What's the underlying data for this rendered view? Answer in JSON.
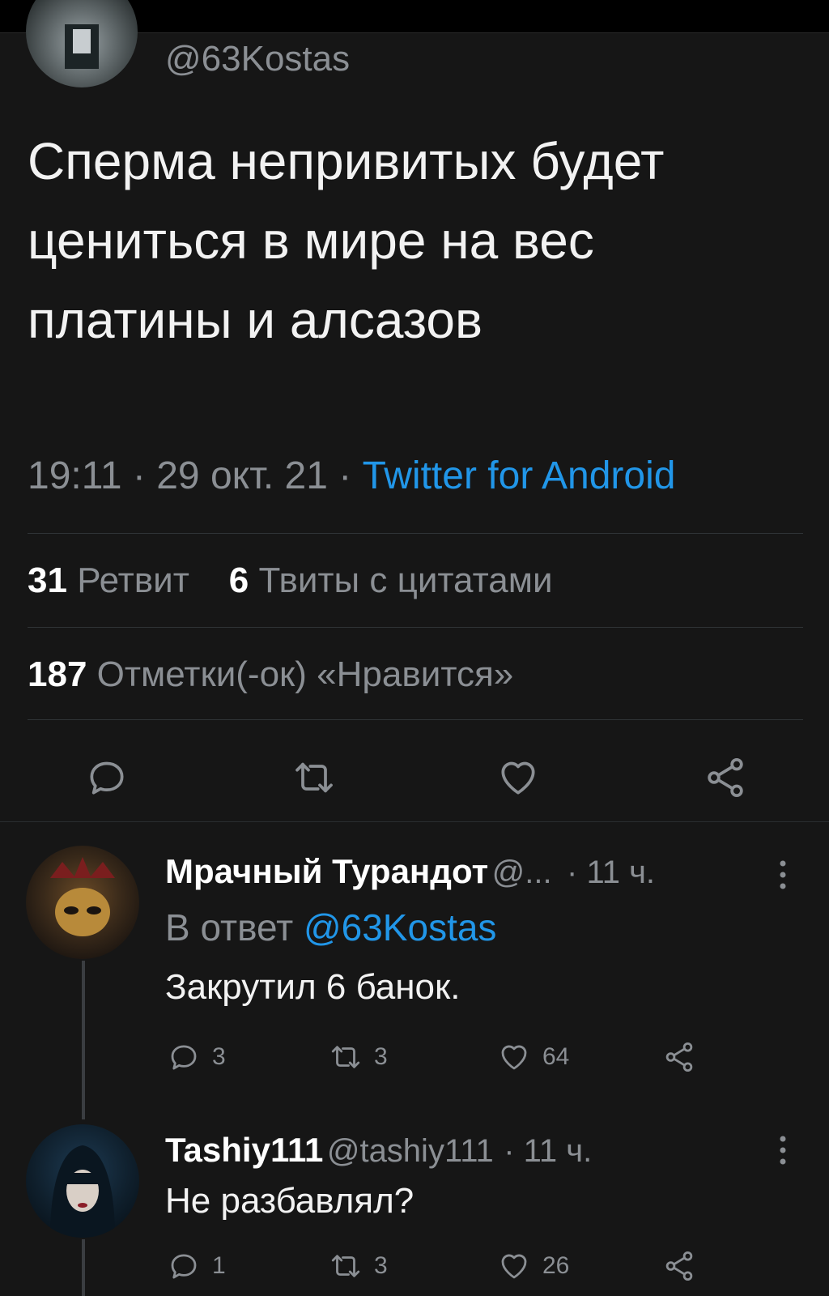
{
  "tweet": {
    "handle": "@63Kostas",
    "text": "Сперма непривитых будет цениться в мире на вес платины и алсазов",
    "time": "19:11",
    "sep1": "·",
    "date": "29 окт. 21",
    "sep2": "·",
    "source": "Twitter for Android",
    "retweets_count": "31",
    "retweets_label": "Ретвит",
    "quotes_count": "6",
    "quotes_label": "Твиты с цитатами",
    "likes_count": "187",
    "likes_label": "Отметки(-ок) «Нравится»"
  },
  "replies": [
    {
      "name": "Мрачный Турандот",
      "handle": "@...",
      "time": "· 11 ч.",
      "reply_prefix": "В ответ",
      "reply_to": "@63Kostas",
      "text": "Закрутил 6 банок.",
      "replies": "3",
      "retweets": "3",
      "likes": "64"
    },
    {
      "name": "Tashiy111",
      "handle": "@tashiy111",
      "time": "· 11 ч.",
      "text": "Не разбавлял?",
      "replies": "1",
      "retweets": "3",
      "likes": "26"
    }
  ],
  "icons": {
    "reply": "reply-icon",
    "retweet": "retweet-icon",
    "like": "heart-icon",
    "share": "share-icon",
    "more": "more-icon"
  },
  "colors": {
    "background": "#161616",
    "link": "#2196e8",
    "muted": "#8b8f94"
  }
}
